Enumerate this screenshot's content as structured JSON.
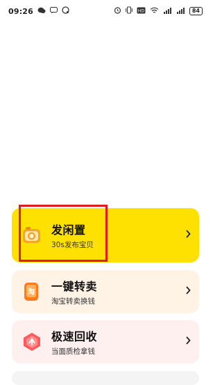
{
  "status_bar": {
    "time": "09:26",
    "battery": "84",
    "icons": [
      "wechat-icon",
      "chat-icon",
      "alarm-icon",
      "vibrate-icon",
      "hd-icon",
      "wifi-icon",
      "signal-icon",
      "signal-icon",
      "battery-icon"
    ]
  },
  "cards": {
    "sell": {
      "title": "发闲置",
      "subtitle": "30s发布宝贝"
    },
    "resell": {
      "title": "一键转卖",
      "subtitle": "淘宝转卖换钱"
    },
    "recycle": {
      "title": "极速回收",
      "subtitle": "当面质检拿钱"
    }
  },
  "colors": {
    "sell_bg": "#ffe100",
    "resell_bg": "#fff3e6",
    "recycle_bg": "#fff0f0",
    "highlight": "#e01b1b"
  }
}
